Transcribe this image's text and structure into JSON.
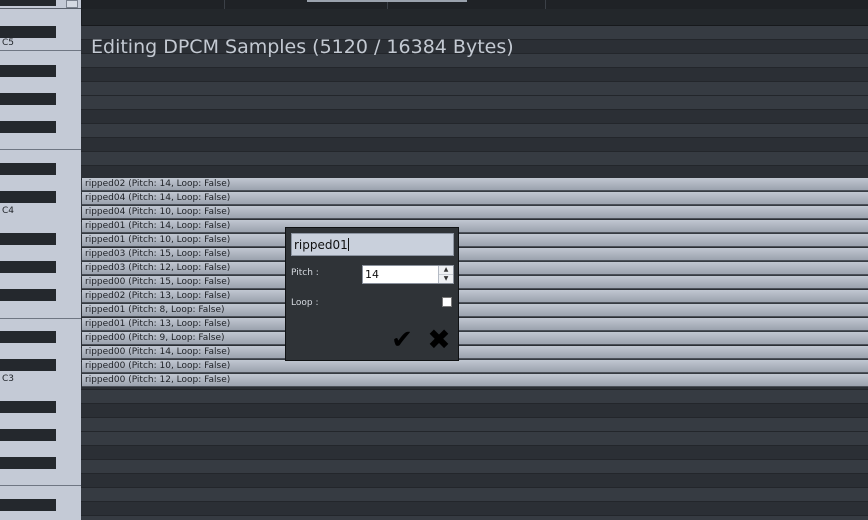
{
  "title": "Editing DPCM Samples (5120 / 16384 Bytes)",
  "keyboard": {
    "octave_labels": [
      "C5",
      "C4",
      "C3"
    ]
  },
  "samples": [
    "ripped02 (Pitch: 14, Loop: False)",
    "ripped04 (Pitch: 14, Loop: False)",
    "ripped04 (Pitch: 10, Loop: False)",
    "ripped01 (Pitch: 14, Loop: False)",
    "ripped01 (Pitch: 10, Loop: False)",
    "ripped03 (Pitch: 15, Loop: False)",
    "ripped03 (Pitch: 12, Loop: False)",
    "ripped00 (Pitch: 15, Loop: False)",
    "ripped02 (Pitch: 13, Loop: False)",
    "ripped01 (Pitch: 8, Loop: False)",
    "ripped01 (Pitch: 13, Loop: False)",
    "ripped00 (Pitch: 9, Loop: False)",
    "ripped00 (Pitch: 14, Loop: False)",
    "ripped00 (Pitch: 10, Loop: False)",
    "ripped00 (Pitch: 12, Loop: False)"
  ],
  "dialog": {
    "name_value": "ripped01",
    "pitch_label": "Pitch :",
    "pitch_value": "14",
    "loop_label": "Loop :",
    "loop_checked": false,
    "ok_icon": "checkmark-icon",
    "cancel_icon": "x-icon"
  }
}
